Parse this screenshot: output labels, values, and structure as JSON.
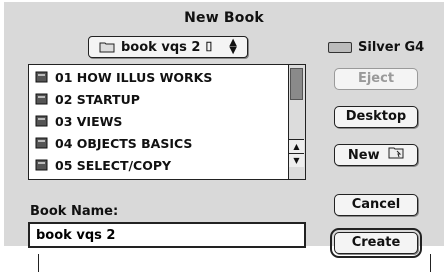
{
  "dialog": {
    "title": "New Book",
    "folder_popup": {
      "selected": "book vqs 2 ⌷",
      "icon": "folder-icon"
    },
    "volume": {
      "label": "Silver G4",
      "icon": "hard-drive-icon"
    },
    "file_list": {
      "items": [
        {
          "label": "01 HOW ILLUS WORKS",
          "icon": "book-icon"
        },
        {
          "label": "02 STARTUP",
          "icon": "book-icon"
        },
        {
          "label": "03 VIEWS",
          "icon": "book-icon"
        },
        {
          "label": "04 OBJECTS BASICS",
          "icon": "book-icon"
        },
        {
          "label": "05 SELECT/COPY",
          "icon": "book-icon"
        }
      ]
    },
    "buttons": {
      "eject": "Eject",
      "desktop": "Desktop",
      "new": "New",
      "cancel": "Cancel",
      "create": "Create"
    },
    "book_name": {
      "label": "Book Name:",
      "value": "book vqs 2"
    }
  }
}
